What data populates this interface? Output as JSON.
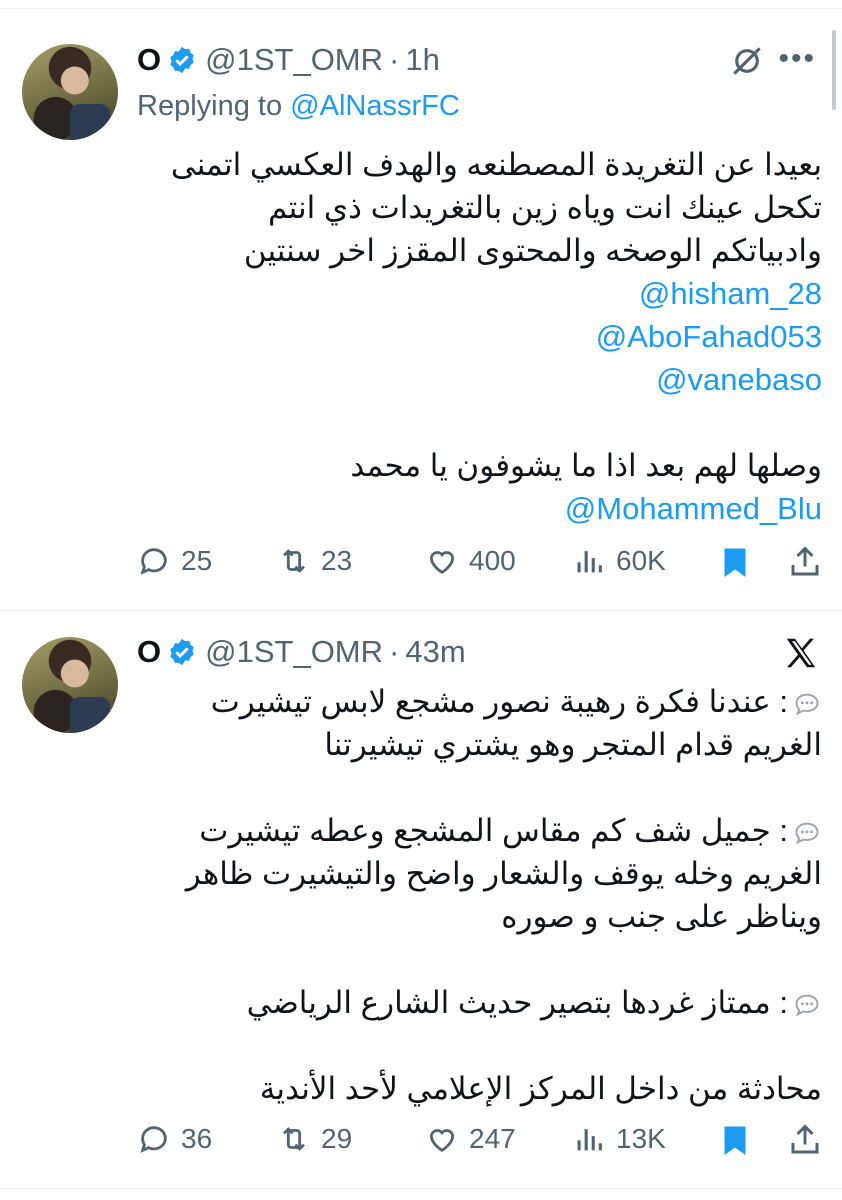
{
  "tweets": [
    {
      "name": "O",
      "handle": "@1ST_OMR",
      "separator": "·",
      "time": "1h",
      "replying_prefix": "Replying to ",
      "replying_to": "@AlNassrFC",
      "text_lines": [
        "بعيدا عن التغريدة المصطنعه والهدف العكسي اتمنى",
        "تكحل عينك انت وياه زين بالتغريدات ذي انتم",
        "وادبياتكم الوصخه والمحتوى المقزز اخر سنتين"
      ],
      "mentions": [
        "@hisham_28",
        "@AboFahad053",
        "@vanebaso"
      ],
      "text_line_2": "وصلها لهم بعد اذا ما يشوفون يا محمد",
      "mention_last": "@Mohammed_Blu",
      "stats": {
        "replies": "25",
        "retweets": "23",
        "likes": "400",
        "views": "60K"
      }
    },
    {
      "name": "O",
      "handle": "@1ST_OMR",
      "separator": "·",
      "time": "43m",
      "lines": [
        ": عندنا فكرة رهيبة نصور مشجع لابس تيشيرت",
        "الغريم قدام المتجر وهو يشتري تيشيرتنا",
        ": جميل شف كم مقاس المشجع وعطه تيشيرت",
        "الغريم وخله يوقف والشعار واضح والتيشيرت ظاهر",
        "ويناظر على جنب و صوره",
        ": ممتاز غردها بتصير حديث الشارع الرياضي",
        "محادثة من داخل المركز الإعلامي لأحد الأندية"
      ],
      "stats": {
        "replies": "36",
        "retweets": "29",
        "likes": "247",
        "views": "13K"
      }
    }
  ],
  "colors": {
    "accent": "#1d9bf0",
    "muted": "#536471",
    "text": "#0f1419"
  },
  "icons": [
    "verified-badge-icon",
    "more-icon",
    "slash-circle-icon",
    "x-logo-icon",
    "reply-icon",
    "retweet-icon",
    "like-icon",
    "views-icon",
    "bookmark-icon",
    "share-icon",
    "speech-bubble-icon"
  ]
}
